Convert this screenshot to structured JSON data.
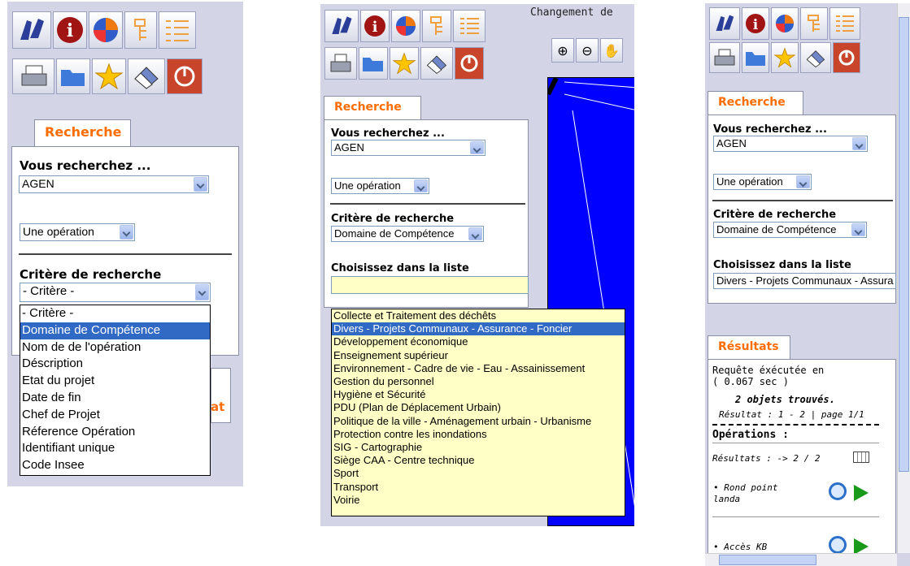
{
  "tab_recherche": "Recherche",
  "tab_resultats": "Résultats",
  "vous_recherchez": "Vous recherchez ...",
  "selected_value": "AGEN",
  "operation_select": "Une opération",
  "critere_label": "Critère de recherche",
  "critere_placeholder": "- Critère -",
  "critere_selected": "Domaine de Compétence",
  "choisissez_label": "Choisissez dans la liste",
  "choisissez_selected": "Divers - Projets Communaux - Assura",
  "top_bar_text": "Changement de",
  "panel1_cut_text": "at",
  "critere_options": [
    "- Critère -",
    "Domaine de Compétence",
    "Nom de de l'opération",
    "Déscription",
    "Etat du projet",
    "Date de fin",
    "Chef de Projet",
    "Réference Opération",
    "Identifiant unique",
    "Code Insee"
  ],
  "domaine_options": [
    "Collecte et Traitement des déchêts",
    "Divers - Projets Communaux - Assurance - Foncier",
    "Développement économique",
    "Enseignement supérieur",
    "Environnement - Cadre de vie - Eau - Assainissement",
    "Gestion du personnel",
    "Hygiène et Sécurité",
    "PDU (Plan de Déplacement Urbain)",
    "Politique de la ville - Aménagement urbain - Urbanisme",
    "Protection contre les inondations",
    "SIG - Cartographie",
    "Siège CAA - Centre technique",
    "Sport",
    "Transport",
    "Voirie"
  ],
  "results": {
    "req_line1": "Requête éxécutée en",
    "req_line2": "( 0.067 sec )",
    "found": "2 objets trouvés.",
    "pagination": "Résultat : 1 - 2 | page 1/1",
    "operations": "Opérations :",
    "results_count": "Résultats : -> 2 / 2",
    "items": [
      "• Rond point landa",
      "• Accès KB"
    ]
  },
  "icons": [
    "binoculars-icon",
    "info-icon",
    "globe-icon",
    "tree-icon",
    "list-icon",
    "print-icon",
    "folder-open-icon",
    "star-icon",
    "eraser-icon",
    "power-icon",
    "zoom-in-icon",
    "zoom-out-icon",
    "pan-hand-icon",
    "magnifier-icon",
    "arrow-right-icon",
    "table-icon"
  ],
  "colors": {
    "panel_bg": "#d3d5e6",
    "tab_text": "#ff6d00",
    "highlight": "#316ac5",
    "map_bg": "#0000ff",
    "list_bg": "#ffffc6"
  }
}
